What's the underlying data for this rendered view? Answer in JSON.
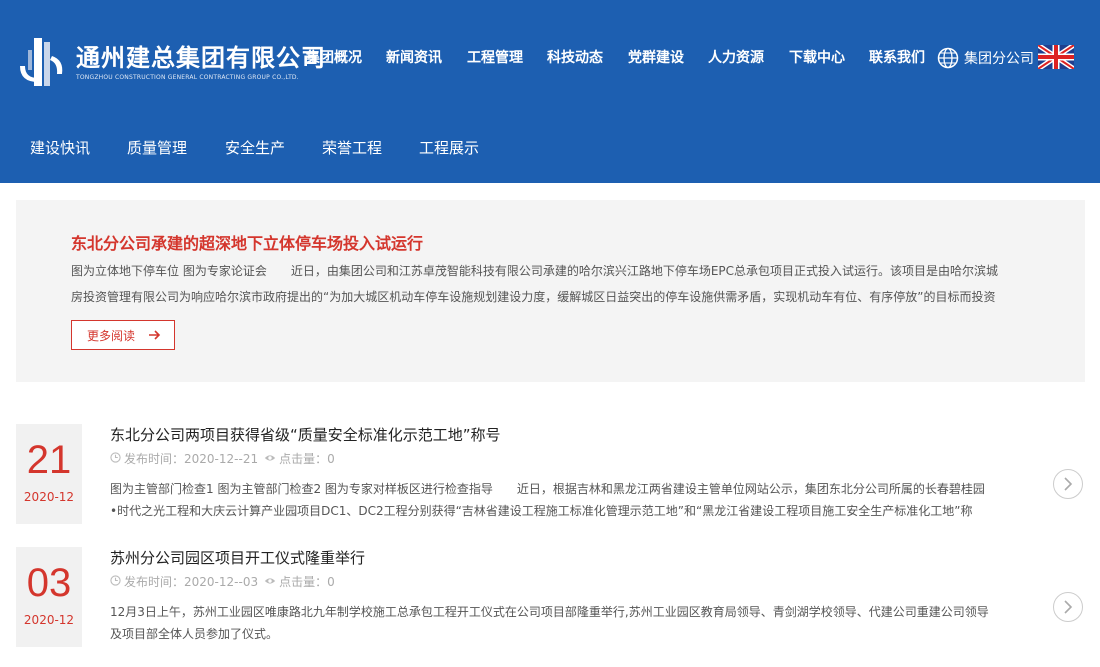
{
  "brand": {
    "name_cn": "通州建总集团有限公司",
    "name_en": "TONGZHOU CONSTRUCTION GENERAL CONTRACTING GROUP CO.,LTD."
  },
  "topnav": [
    "集团概况",
    "新闻资讯",
    "工程管理",
    "科技动态",
    "党群建设",
    "人力资源",
    "下载中心",
    "联系我们"
  ],
  "branch_label": "集团分公司",
  "subnav": [
    "建设快讯",
    "质量管理",
    "安全生产",
    "荣誉工程",
    "工程展示"
  ],
  "featured": {
    "title": "东北分公司承建的超深地下立体停车场投入试运行",
    "text": "图为立体地下停车位 图为专家论证会　　近日，由集团公司和江苏卓茂智能科技有限公司承建的哈尔滨兴江路地下停车场EPC总承包项目正式投入试运行。该项目是由哈尔滨城房投资管理有限公司为响应哈尔滨市政府提出的“为加大城区机动车停车设施规划建设力度，缓解城区日益突出的停车设施供需矛盾，实现机动车有位、有序停放”的目标而投资建设的民生工",
    "more_label": "更多阅读"
  },
  "news": [
    {
      "day": "21",
      "ym": "2020-12",
      "title": "东北分公司两项目获得省级“质量安全标准化示范工地”称号",
      "publish_label": "发布时间：",
      "publish_date": "2020-12--21",
      "clicks_label": "点击量：",
      "clicks": "0",
      "excerpt": "图为主管部门检查1 图为主管部门检查2 图为专家对样板区进行检查指导　　近日，根据吉林和黑龙江两省建设主管单位网站公示，集团东北分公司所属的长春碧桂园•时代之光工程和大庆云计算产业园项目DC1、DC2工程分别获得“吉林省建设工程施工标准化管理示范工地”和“黑龙江省建设工程项目施工安全生产标准化工地”称号。特别是“吉林省"
    },
    {
      "day": "03",
      "ym": "2020-12",
      "title": "苏州分公司园区项目开工仪式隆重举行",
      "publish_label": "发布时间：",
      "publish_date": "2020-12--03",
      "clicks_label": "点击量：",
      "clicks": "0",
      "excerpt": "12月3日上午，苏州工业园区唯康路北九年制学校施工总承包工程开工仪式在公司项目部隆重举行,苏州工业园区教育局领导、青剑湖学校领导、代建公司重建公司领导及项目部全体人员参加了仪式。"
    }
  ],
  "colors": {
    "header_bg": "#1d5fb1",
    "accent_red": "#d4362d",
    "featured_bg": "#f4f4f4",
    "date_bg": "#f1f1f1"
  }
}
